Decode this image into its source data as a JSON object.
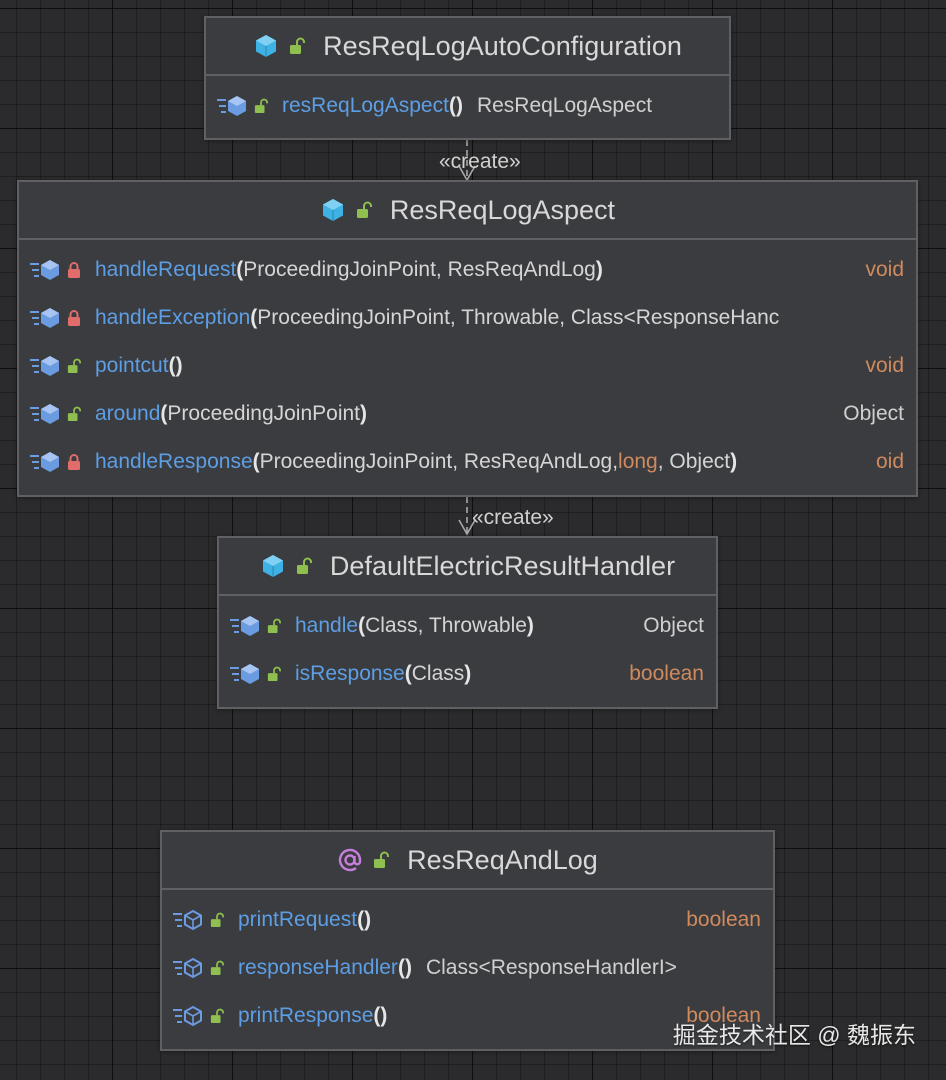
{
  "colors": {
    "method_name": "#5d9ee5",
    "primitive_type": "#cf8a5e",
    "public_lock": "#8fbf4f",
    "private_lock": "#e06c6c",
    "class_icon": "#3fb2e5",
    "annotation_icon": "#c77dde"
  },
  "edges": [
    {
      "label": "«create»"
    },
    {
      "label": "«create»"
    }
  ],
  "classes": [
    {
      "name": "ResReqLogAutoConfiguration",
      "kind_icon": "class-icon",
      "methods": [
        {
          "name": "resReqLogAspect",
          "open": "(",
          "params": "",
          "close": ")",
          "ret": "ResReqLogAspect",
          "lock": "public"
        }
      ]
    },
    {
      "name": "ResReqLogAspect",
      "kind_icon": "class-icon",
      "methods": [
        {
          "name": "handleRequest",
          "open": "(",
          "params": "ProceedingJoinPoint, ResReqAndLog",
          "close": ")",
          "ret": "void",
          "lock": "private"
        },
        {
          "name": "handleException",
          "open": "(",
          "params": "ProceedingJoinPoint, Throwable, Class<ResponseHanc",
          "close": "",
          "ret": "",
          "lock": "private"
        },
        {
          "name": "pointcut",
          "open": "(",
          "params": "",
          "close": ")",
          "ret": "void",
          "lock": "public"
        },
        {
          "name": "around",
          "open": "(",
          "params": "ProceedingJoinPoint",
          "close": ")",
          "ret": "Object",
          "lock": "public"
        },
        {
          "name": "handleResponse",
          "open": "(",
          "params_a": "ProceedingJoinPoint, ResReqAndLog, ",
          "params_hl": "long",
          "params_b": ", Object",
          "close": ")",
          "ret": "oid",
          "lock": "private"
        }
      ]
    },
    {
      "name": "DefaultElectricResultHandler",
      "kind_icon": "class-icon",
      "methods": [
        {
          "name": "handle",
          "open": "(",
          "params": "Class, Throwable",
          "close": ")",
          "ret": "Object",
          "lock": "public"
        },
        {
          "name": "isResponse",
          "open": "(",
          "params": "Class",
          "close": ")",
          "ret": "boolean",
          "lock": "public"
        }
      ]
    },
    {
      "name": "ResReqAndLog",
      "kind_icon": "annotation-icon",
      "methods": [
        {
          "name": "printRequest",
          "open": "(",
          "params": "",
          "close": ")",
          "ret": "boolean",
          "lock": "public"
        },
        {
          "name": "responseHandler",
          "open": "(",
          "params": "",
          "close": ")",
          "ret": "Class<ResponseHandlerI>",
          "lock": "public"
        },
        {
          "name": "printResponse",
          "open": "(",
          "params": "",
          "close": ")",
          "ret": "boolean",
          "lock": "public"
        }
      ]
    }
  ],
  "watermark": "掘金技术社区 @ 魏振东"
}
